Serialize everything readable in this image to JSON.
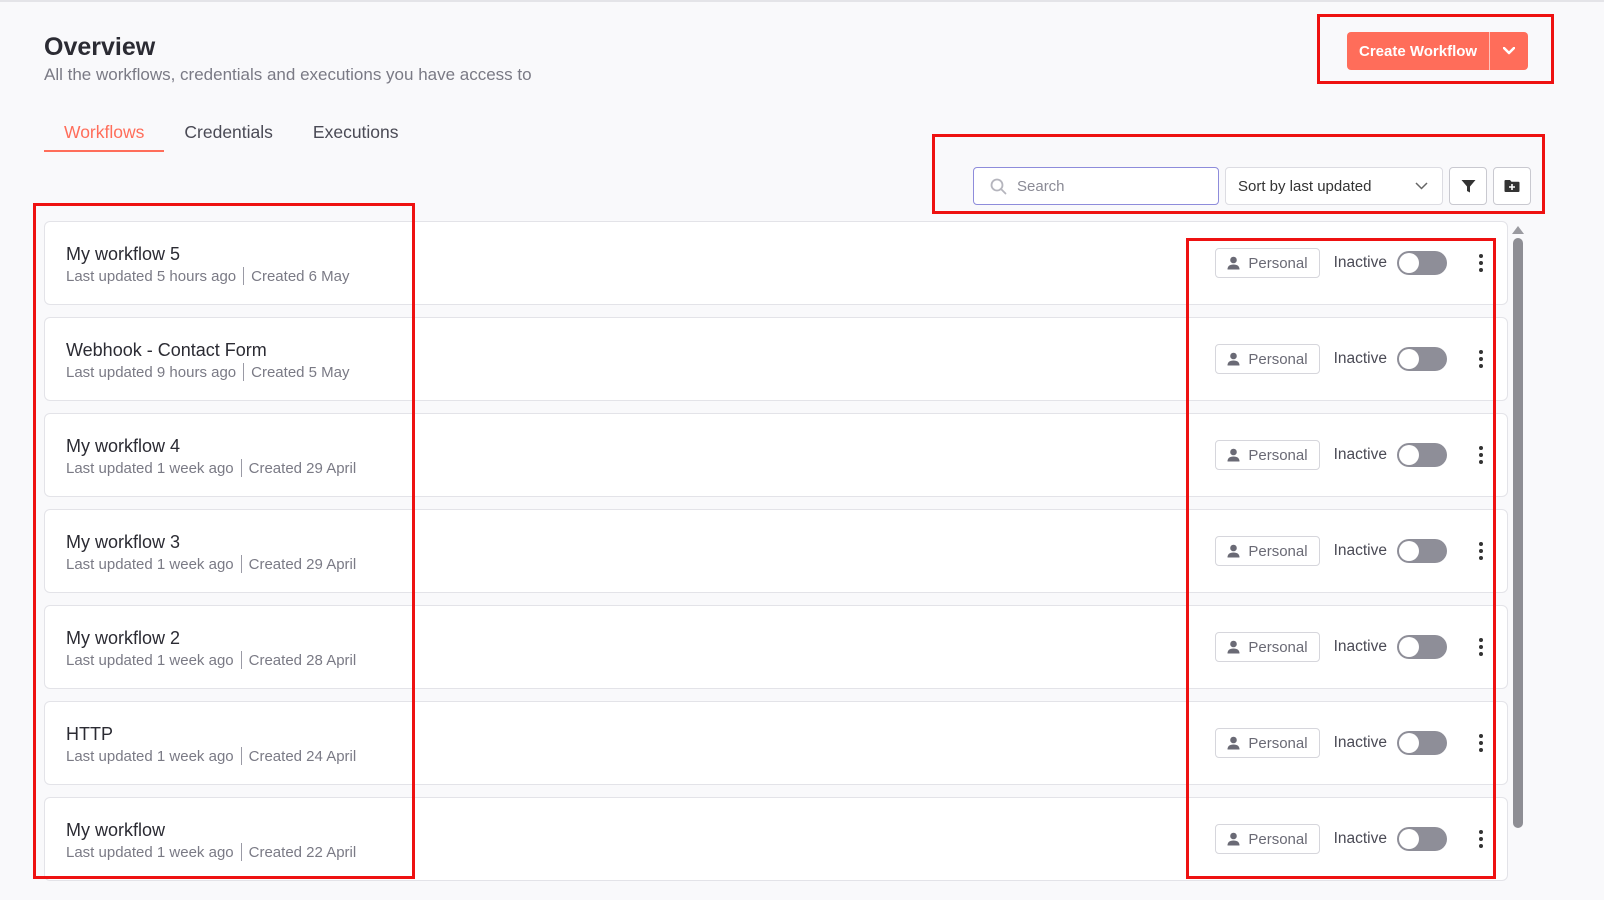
{
  "header": {
    "title": "Overview",
    "subtitle": "All the workflows, credentials and executions you have access to",
    "create_label": "Create Workflow"
  },
  "tabs": [
    {
      "label": "Workflows",
      "active": true
    },
    {
      "label": "Credentials",
      "active": false
    },
    {
      "label": "Executions",
      "active": false
    }
  ],
  "toolbar": {
    "search_placeholder": "Search",
    "sort_label": "Sort by last updated"
  },
  "workflows": [
    {
      "name": "My workflow 5",
      "updated": "Last updated 5 hours ago",
      "created": "Created 6 May",
      "owner": "Personal",
      "status": "Inactive"
    },
    {
      "name": "Webhook - Contact Form",
      "updated": "Last updated 9 hours ago",
      "created": "Created 5 May",
      "owner": "Personal",
      "status": "Inactive"
    },
    {
      "name": "My workflow 4",
      "updated": "Last updated 1 week ago",
      "created": "Created 29 April",
      "owner": "Personal",
      "status": "Inactive"
    },
    {
      "name": "My workflow 3",
      "updated": "Last updated 1 week ago",
      "created": "Created 29 April",
      "owner": "Personal",
      "status": "Inactive"
    },
    {
      "name": "My workflow 2",
      "updated": "Last updated 1 week ago",
      "created": "Created 28 April",
      "owner": "Personal",
      "status": "Inactive"
    },
    {
      "name": "HTTP",
      "updated": "Last updated 1 week ago",
      "created": "Created 24 April",
      "owner": "Personal",
      "status": "Inactive"
    },
    {
      "name": "My workflow",
      "updated": "Last updated 1 week ago",
      "created": "Created 22 April",
      "owner": "Personal",
      "status": "Inactive"
    }
  ],
  "colors": {
    "accent": "#ff6d5a",
    "highlight": "#ee1111"
  }
}
